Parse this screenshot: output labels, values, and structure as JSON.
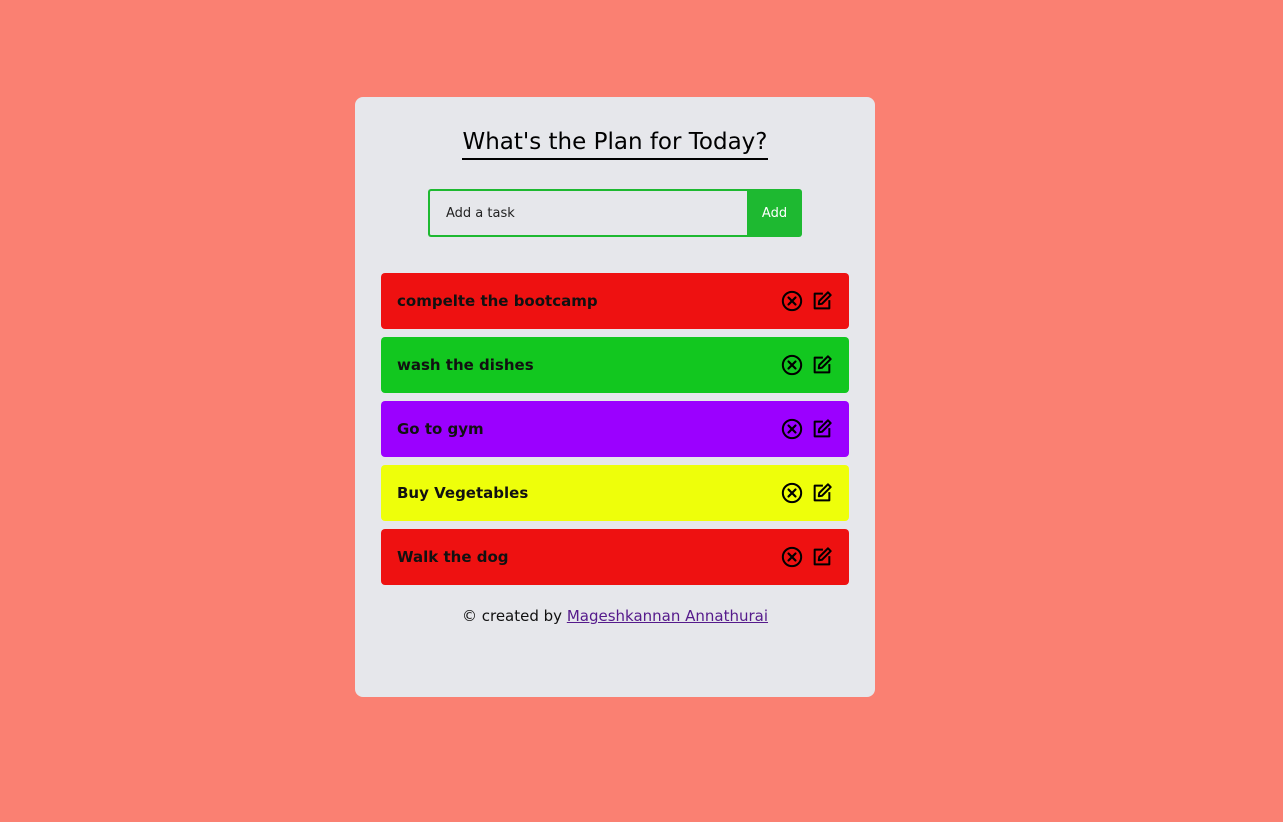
{
  "app": {
    "title": "What's the Plan for Today?"
  },
  "form": {
    "placeholder": "Add a task",
    "value": "",
    "add_label": "Add"
  },
  "todos": [
    {
      "text": "compelte the bootcamp",
      "color": "#ee1111"
    },
    {
      "text": "wash the dishes",
      "color": "#12c71f"
    },
    {
      "text": "Go to gym",
      "color": "#9b00ff"
    },
    {
      "text": "Buy Vegetables",
      "color": "#eeff0a"
    },
    {
      "text": "Walk the dog",
      "color": "#ee1111"
    }
  ],
  "icons": {
    "delete": "close-circle-icon",
    "edit": "edit-icon"
  },
  "footer": {
    "prefix": "© created by ",
    "author": "Mageshkannan Annathurai"
  },
  "colors": {
    "background": "#fa8072",
    "card": "#e6e7eb",
    "accent": "#1eb931"
  }
}
